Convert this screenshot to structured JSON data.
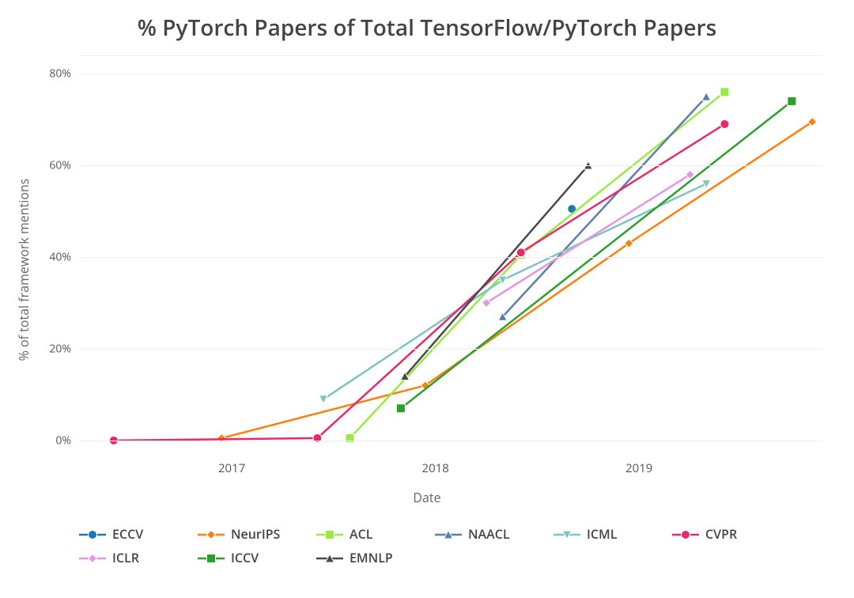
{
  "chart_data": {
    "type": "line",
    "title": "% PyTorch Papers of Total TensorFlow/PyTorch Papers",
    "xlabel": "Date",
    "ylabel": "% of total framework mentions",
    "xlim": [
      2016.25,
      2019.9
    ],
    "ylim": [
      -4,
      84
    ],
    "x_ticks": [
      2017,
      2018,
      2019
    ],
    "x_tick_labels": [
      "2017",
      "2018",
      "2019"
    ],
    "y_ticks": [
      0,
      20,
      40,
      60,
      80
    ],
    "y_tick_labels": [
      "0%",
      "20%",
      "40%",
      "60%",
      "80%"
    ],
    "series_order": [
      "ECCV",
      "NeurIPS",
      "ACL",
      "NAACL",
      "ICML",
      "CVPR",
      "ICLR",
      "ICCV",
      "EMNLP"
    ],
    "series": {
      "ECCV": {
        "color": "#1f77b4",
        "marker": "circle",
        "points": [
          {
            "x": 2018.67,
            "y": 50.5
          }
        ]
      },
      "NeurIPS": {
        "color": "#ff7f0e",
        "marker": "diamond",
        "points": [
          {
            "x": 2016.95,
            "y": 0.5
          },
          {
            "x": 2017.95,
            "y": 12
          },
          {
            "x": 2018.95,
            "y": 43
          },
          {
            "x": 2019.85,
            "y": 69.5
          }
        ]
      },
      "ACL": {
        "color": "#9be948",
        "marker": "square",
        "points": [
          {
            "x": 2017.58,
            "y": 0.5
          },
          {
            "x": 2018.42,
            "y": 40.5
          },
          {
            "x": 2019.42,
            "y": 76
          }
        ]
      },
      "NAACL": {
        "color": "#5d7fa6",
        "marker": "triangle-up",
        "points": [
          {
            "x": 2018.33,
            "y": 27
          },
          {
            "x": 2019.33,
            "y": 75
          }
        ]
      },
      "ICML": {
        "color": "#7ec4c4",
        "marker": "triangle-down",
        "points": [
          {
            "x": 2017.45,
            "y": 9
          },
          {
            "x": 2018.33,
            "y": 35
          },
          {
            "x": 2019.33,
            "y": 56
          }
        ]
      },
      "CVPR": {
        "color": "#e6296b",
        "marker": "circle",
        "points": [
          {
            "x": 2016.42,
            "y": 0.0
          },
          {
            "x": 2017.42,
            "y": 0.5
          },
          {
            "x": 2018.42,
            "y": 41
          },
          {
            "x": 2019.42,
            "y": 69
          }
        ]
      },
      "ICLR": {
        "color": "#e396e3",
        "marker": "diamond",
        "points": [
          {
            "x": 2018.25,
            "y": 30
          },
          {
            "x": 2019.25,
            "y": 58
          }
        ]
      },
      "ICCV": {
        "color": "#2ca02c",
        "marker": "square",
        "points": [
          {
            "x": 2017.83,
            "y": 7
          },
          {
            "x": 2019.75,
            "y": 74
          }
        ]
      },
      "EMNLP": {
        "color": "#4a4a4a",
        "marker": "triangle-up",
        "points": [
          {
            "x": 2017.85,
            "y": 14
          },
          {
            "x": 2018.75,
            "y": 60
          }
        ]
      }
    },
    "legend_position": "bottom"
  }
}
